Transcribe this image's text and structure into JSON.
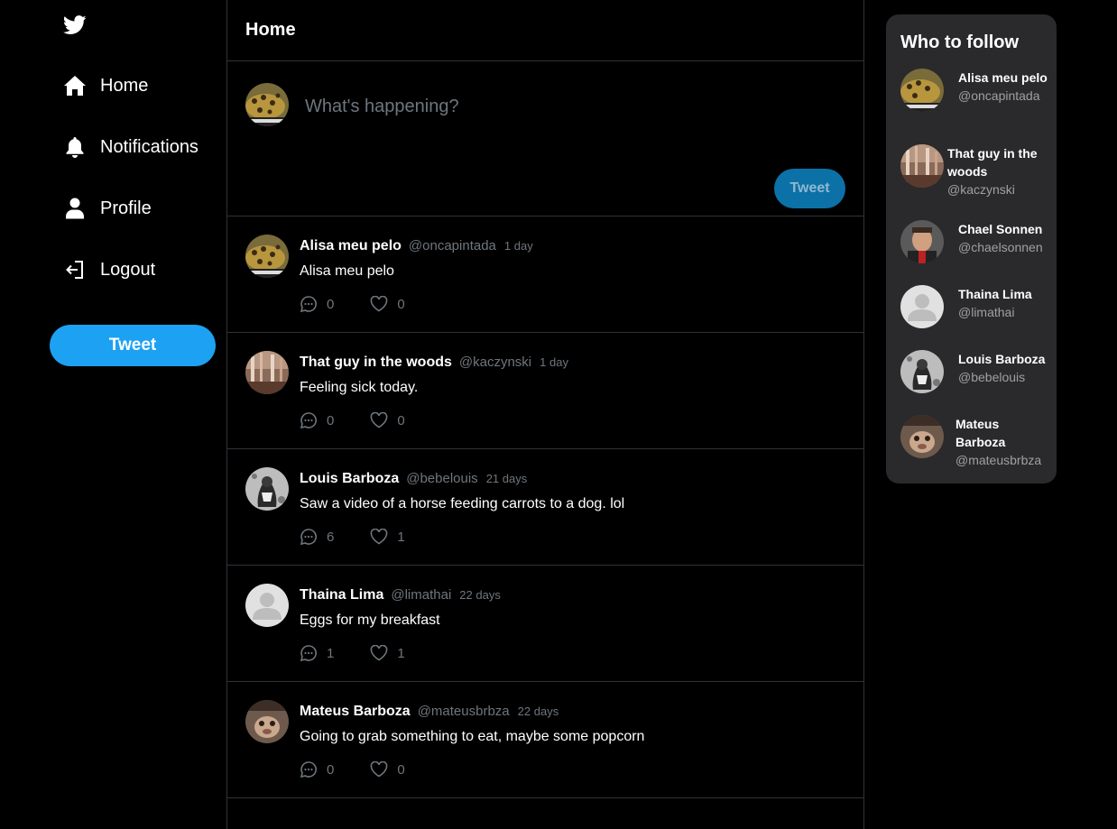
{
  "sidebar": {
    "logo_icon": "twitter-bird-icon",
    "items": [
      {
        "label": "Home",
        "icon": "home-icon"
      },
      {
        "label": "Notifications",
        "icon": "bell-icon"
      },
      {
        "label": "Profile",
        "icon": "user-icon"
      },
      {
        "label": "Logout",
        "icon": "logout-icon"
      }
    ],
    "tweet_button_label": "Tweet"
  },
  "main": {
    "title": "Home",
    "composer": {
      "placeholder": "What's happening?",
      "button_label": "Tweet"
    },
    "tweets": [
      {
        "name": "Alisa meu pelo",
        "handle": "@oncapintada",
        "time": "1 day",
        "text": "Alisa meu pelo",
        "replies": "0",
        "likes": "0"
      },
      {
        "name": "That guy in the woods",
        "handle": "@kaczynski",
        "time": "1 day",
        "text": "Feeling sick today.",
        "replies": "0",
        "likes": "0"
      },
      {
        "name": "Louis Barboza",
        "handle": "@bebelouis",
        "time": "21 days",
        "text": "Saw a video of a horse feeding carrots to a dog. lol",
        "replies": "6",
        "likes": "1"
      },
      {
        "name": "Thaina Lima",
        "handle": "@limathai",
        "time": "22 days",
        "text": "Eggs for my breakfast",
        "replies": "1",
        "likes": "1"
      },
      {
        "name": "Mateus Barboza",
        "handle": "@mateusbrbza",
        "time": "22 days",
        "text": "Going to grab something to eat, maybe some popcorn",
        "replies": "0",
        "likes": "0"
      }
    ]
  },
  "who_to_follow": {
    "title": "Who to follow",
    "users": [
      {
        "name": "Alisa meu pelo",
        "handle": "@oncapintada"
      },
      {
        "name": "That guy in the woods",
        "handle": "@kaczynski"
      },
      {
        "name": "Chael Sonnen",
        "handle": "@chaelsonnen"
      },
      {
        "name": "Thaina Lima",
        "handle": "@limathai"
      },
      {
        "name": "Louis Barboza",
        "handle": "@bebelouis"
      },
      {
        "name": "Mateus Barboza",
        "handle": "@mateusbrbza"
      }
    ]
  },
  "colors": {
    "accent": "#1da1f2",
    "composer_button": "#0c71a7",
    "muted_text": "#6e767d",
    "card_background": "#2a2a2c"
  }
}
